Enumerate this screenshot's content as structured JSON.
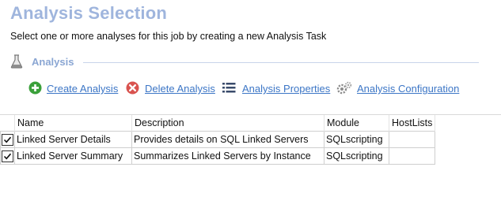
{
  "page": {
    "title": "Analysis Selection",
    "subtitle": "Select one or more analyses for this job by creating a new Analysis Task"
  },
  "section": {
    "label": "Analysis",
    "icon": "flask-icon"
  },
  "toolbar": {
    "create": {
      "label": "Create Analysis",
      "icon": "add-circle-icon"
    },
    "delete": {
      "label": "Delete Analysis",
      "icon": "delete-circle-icon"
    },
    "properties": {
      "label": "Analysis Properties",
      "icon": "list-icon"
    },
    "configuration": {
      "label": "Analysis Configuration",
      "icon": "gears-icon"
    }
  },
  "grid": {
    "columns": [
      "Name",
      "Description",
      "Module",
      "HostLists"
    ],
    "rows": [
      {
        "checked": true,
        "name": "Linked Server Details",
        "description": "Provides details on SQL Linked Servers",
        "module": "SQLscripting",
        "hostlists": ""
      },
      {
        "checked": true,
        "name": "Linked Server Summary",
        "description": "Summarizes Linked Servers by Instance",
        "module": "SQLscripting",
        "hostlists": ""
      }
    ]
  },
  "colors": {
    "title": "#9fb5dd",
    "link": "#3c76c6",
    "add_green": "#3aa03a",
    "delete_red": "#d9534f"
  }
}
